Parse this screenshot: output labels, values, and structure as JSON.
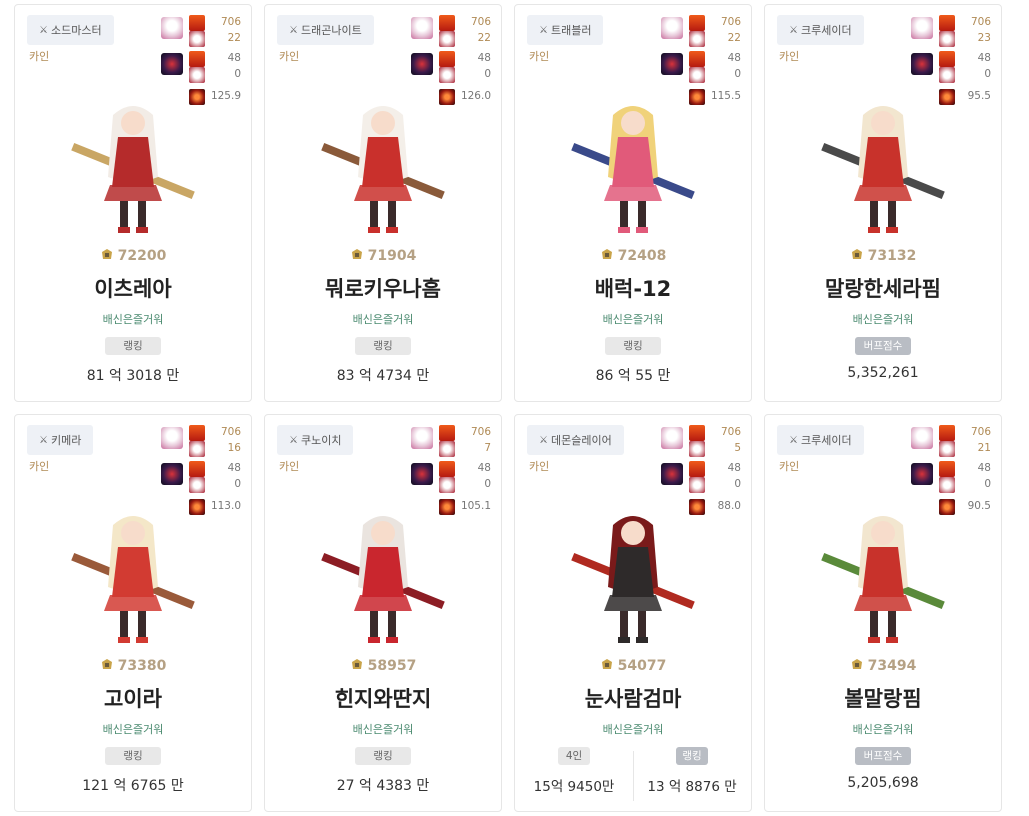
{
  "cards": [
    {
      "job": "소드마스터",
      "server": "카인",
      "s1": "706",
      "s2": "22",
      "s3": "48",
      "s4": "0",
      "s5": "125.9",
      "fame": "72200",
      "name": "이츠레아",
      "guild": "배신은즐거워",
      "badge": "랭킹",
      "value": "81 억 3018 만",
      "badge_style": "ranking",
      "colors": {
        "hair": "#f2ece6",
        "outfit": "#b52b2b",
        "weapon": "#c9a664"
      }
    },
    {
      "job": "드래곤나이트",
      "server": "카인",
      "s1": "706",
      "s2": "22",
      "s3": "48",
      "s4": "0",
      "s5": "126.0",
      "fame": "71904",
      "name": "뭐로키우나흠",
      "guild": "배신은즐거워",
      "badge": "랭킹",
      "value": "83 억 4734 만",
      "badge_style": "ranking",
      "colors": {
        "hair": "#f4efe9",
        "outfit": "#c9302c",
        "weapon": "#8a5a3a"
      }
    },
    {
      "job": "트래블러",
      "server": "카인",
      "s1": "706",
      "s2": "22",
      "s3": "48",
      "s4": "0",
      "s5": "115.5",
      "fame": "72408",
      "name": "배럭-12",
      "guild": "배신은즐거워",
      "badge": "랭킹",
      "value": "86 억 55 만",
      "badge_style": "ranking",
      "colors": {
        "hair": "#f0d27a",
        "outfit": "#e15a7a",
        "weapon": "#3a4a8a"
      }
    },
    {
      "job": "크루세이더",
      "server": "카인",
      "s1": "706",
      "s2": "23",
      "s3": "48",
      "s4": "0",
      "s5": "95.5",
      "fame": "73132",
      "name": "말랑한세라핌",
      "guild": "배신은즐거워",
      "badge": "버프점수",
      "value": "5,352,261",
      "badge_style": "buff",
      "colors": {
        "hair": "#f2e6cf",
        "outfit": "#c8322b",
        "weapon": "#4a4a4a"
      }
    },
    {
      "job": "키메라",
      "server": "카인",
      "s1": "706",
      "s2": "16",
      "s3": "48",
      "s4": "0",
      "s5": "113.0",
      "fame": "73380",
      "name": "고이라",
      "guild": "배신은즐거워",
      "badge": "랭킹",
      "value": "121 억 6765 만",
      "badge_style": "ranking",
      "colors": {
        "hair": "#f4e7c8",
        "outfit": "#d23b32",
        "weapon": "#9a5a3a"
      }
    },
    {
      "job": "쿠노이치",
      "server": "카인",
      "s1": "706",
      "s2": "7",
      "s3": "48",
      "s4": "0",
      "s5": "105.1",
      "fame": "58957",
      "name": "힌지와딴지",
      "guild": "배신은즐거워",
      "badge": "랭킹",
      "value": "27 억 4383 만",
      "badge_style": "ranking",
      "colors": {
        "hair": "#eae4df",
        "outfit": "#c9262e",
        "weapon": "#8c1d24"
      }
    },
    {
      "job": "데몬슬레이어",
      "server": "카인",
      "s1": "706",
      "s2": "5",
      "s3": "48",
      "s4": "0",
      "s5": "88.0",
      "fame": "54077",
      "name": "눈사람검마",
      "guild": "배신은즐거워",
      "badge": "4인",
      "value": "15억 9450만",
      "badge2": "랭킹",
      "value2": "13 억 8876 만",
      "badge_style": "split",
      "colors": {
        "hair": "#7a1a1a",
        "outfit": "#2e2a2a",
        "weapon": "#b02a20"
      }
    },
    {
      "job": "크루세이더",
      "server": "카인",
      "s1": "706",
      "s2": "21",
      "s3": "48",
      "s4": "0",
      "s5": "90.5",
      "fame": "73494",
      "name": "볼말랑핌",
      "guild": "배신은즐거워",
      "badge": "버프점수",
      "value": "5,205,698",
      "badge_style": "buff",
      "colors": {
        "hair": "#f2e6cf",
        "outfit": "#c8322b",
        "weapon": "#5a8a3a"
      }
    }
  ],
  "icon_names": {
    "job": "crossed-swords-icon",
    "fame": "laurel-crown-icon",
    "stat_a": "creature-portrait-icon",
    "stat_b": "aura-icon",
    "stat_c": "title-icon",
    "stat_d": "power-icon"
  },
  "accent_colors": {
    "gold": "#b08a55",
    "green": "#4a8a6f",
    "red": "#c62d1f"
  }
}
